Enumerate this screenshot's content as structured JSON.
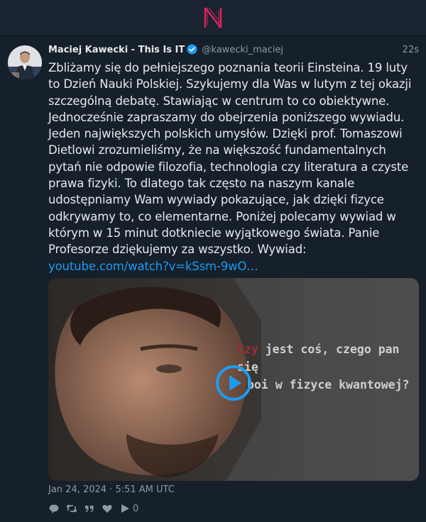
{
  "app": {
    "logo_letter": "N",
    "accent_color": "#e0245e"
  },
  "tweet": {
    "author_name": "Maciej Kawecki - This Is IT",
    "handle": "@kawecki_maciej",
    "time_ago": "22s",
    "verified": true,
    "text_lines": [
      "Zbliżamy się do pełniejszego poznania teorii Einsteina. 19 luty",
      "to Dzień Nauki Polskiej. Szykujemy dla Was w lutym z tej okazji",
      "szczególną debatę. Stawiając w centrum to co obiektywne.",
      "Jednocześnie zapraszamy do obejrzenia poniższego wywiadu.",
      "Jeden największych polskich umysłów. Dzięki prof. Tomaszowi",
      "Dietlowi zrozumieliśmy, że na większość fundamentalnych",
      "pytań nie odpowie filozofia, technologia czy literatura a czyste",
      "prawa fizyki. To dlatego tak często na naszym kanale",
      "udostępniamy Wam wywiady pokazujące, jak dzięki fizyce",
      "odkrywamy to, co elementarne. Poniżej polecamy wywiad w",
      "którym w 15 minut dotkniecie wyjątkowego świata. Panie",
      "Profesorze dziękujemy za wszystko. Wywiad:"
    ],
    "link_text": "youtube.com/watch?v=kSsm-9wO…",
    "video": {
      "caption_highlight": "Czy",
      "caption_line1_rest": " jest coś, czego pan się",
      "caption_line2": "boi w fizyce kwantowej?",
      "play_color": "#1d9bf0"
    },
    "date": "Jan 24, 2024 · 5:51 AM UTC",
    "stats": {
      "quotes": "",
      "likes": "",
      "views": "0"
    }
  },
  "icons": [
    "logo-icon",
    "verified-icon",
    "play-icon",
    "reply-icon",
    "retweet-icon",
    "quote-icon",
    "like-icon",
    "views-icon"
  ]
}
